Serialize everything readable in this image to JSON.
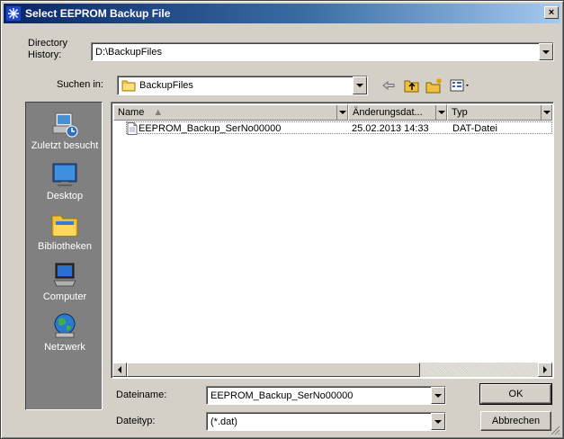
{
  "window": {
    "title": "Select EEPROM Backup File",
    "close_glyph": "×"
  },
  "directory_history": {
    "label_line1": "Directory",
    "label_line2": "History:",
    "value": "D:\\BackupFiles"
  },
  "look_in": {
    "label": "Suchen in:",
    "value": "BackupFiles"
  },
  "toolbar": {
    "back_icon": "back-arrow-icon",
    "up_icon": "folder-up-icon",
    "new_folder_icon": "new-folder-icon",
    "view_icon": "view-menu-icon"
  },
  "places": [
    {
      "label": "Zuletzt besucht",
      "icon": "recent-places-icon"
    },
    {
      "label": "Desktop",
      "icon": "desktop-icon"
    },
    {
      "label": "Bibliotheken",
      "icon": "libraries-icon"
    },
    {
      "label": "Computer",
      "icon": "computer-icon"
    },
    {
      "label": "Netzwerk",
      "icon": "network-icon"
    }
  ],
  "file_list": {
    "columns": [
      "Name",
      "Änderungsdat...",
      "Typ"
    ],
    "rows": [
      {
        "name": "EEPROM_Backup_SerNo00000",
        "modified": "25.02.2013 14:33",
        "type": "DAT-Datei"
      }
    ]
  },
  "filename": {
    "label": "Dateiname:",
    "value": "EEPROM_Backup_SerNo00000"
  },
  "filetype": {
    "label": "Dateityp:",
    "value": "(*.dat)"
  },
  "buttons": {
    "ok": "OK",
    "cancel": "Abbrechen"
  }
}
